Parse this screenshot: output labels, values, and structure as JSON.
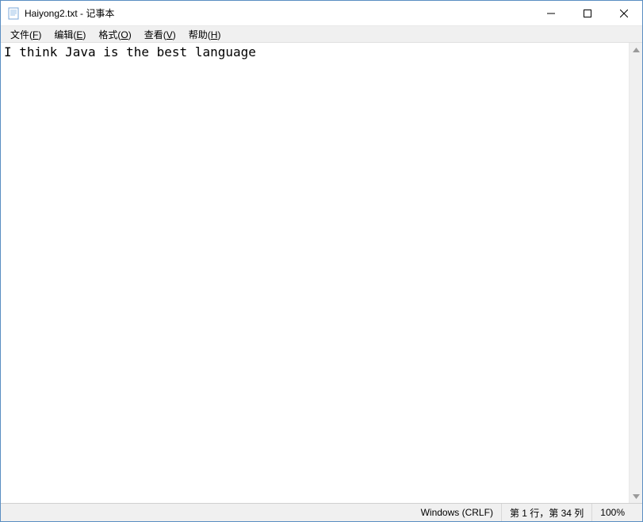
{
  "titlebar": {
    "title": "Haiyong2.txt - 记事本"
  },
  "menubar": {
    "file": {
      "label": "文件",
      "accel": "F"
    },
    "edit": {
      "label": "编辑",
      "accel": "E"
    },
    "format": {
      "label": "格式",
      "accel": "O"
    },
    "view": {
      "label": "查看",
      "accel": "V"
    },
    "help": {
      "label": "帮助",
      "accel": "H"
    }
  },
  "content": {
    "text": "I think Java is the best language"
  },
  "statusbar": {
    "encoding": "Windows (CRLF)",
    "position": "第 1 行，第 34 列",
    "zoom": "100%"
  }
}
